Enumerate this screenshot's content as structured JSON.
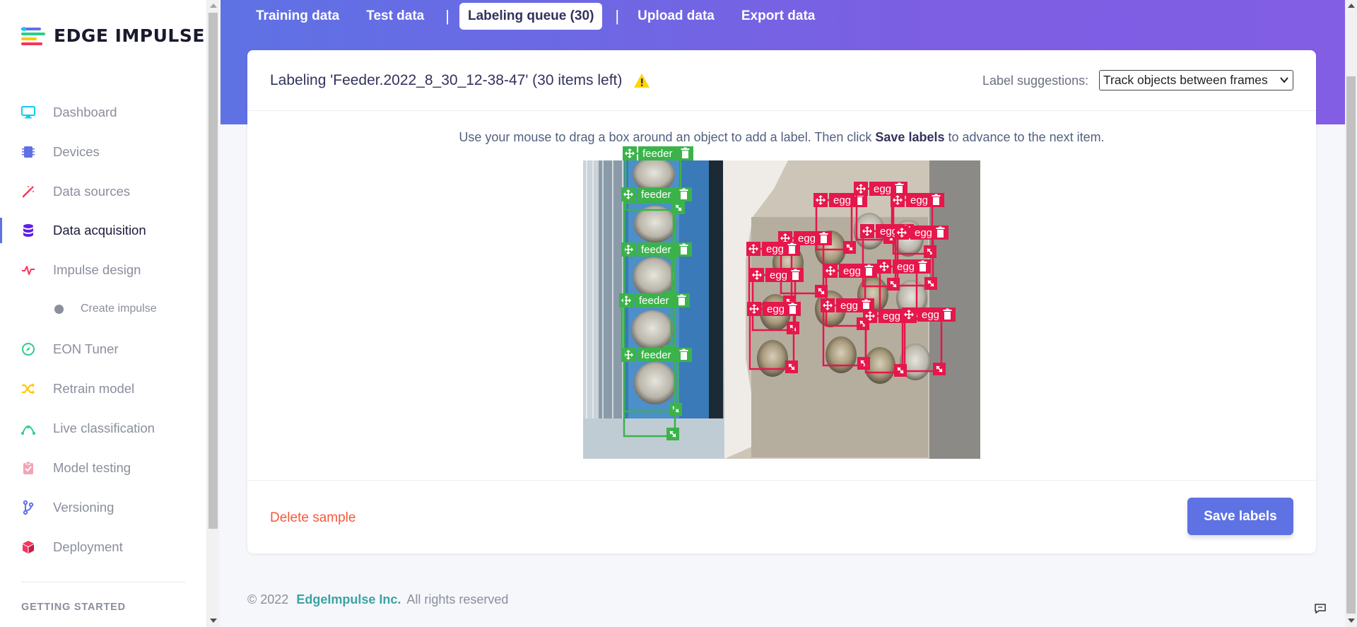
{
  "brand": {
    "name": "EDGE IMPULSE"
  },
  "sidebar": {
    "items": [
      {
        "label": "Dashboard",
        "icon": "monitor-icon",
        "color": "#11cdef"
      },
      {
        "label": "Devices",
        "icon": "chip-icon",
        "color": "#5e72e4"
      },
      {
        "label": "Data sources",
        "icon": "magic-wand-icon",
        "color": "#f5365c"
      },
      {
        "label": "Data acquisition",
        "icon": "database-icon",
        "color": "#5e1fe4"
      },
      {
        "label": "Impulse design",
        "icon": "pulse-icon",
        "color": "#f5365c"
      },
      {
        "label": "EON Tuner",
        "icon": "compass-icon",
        "color": "#2dce89"
      },
      {
        "label": "Retrain model",
        "icon": "shuffle-icon",
        "color": "#ffc800"
      },
      {
        "label": "Live classification",
        "icon": "signal-icon",
        "color": "#2dce89"
      },
      {
        "label": "Model testing",
        "icon": "clipboard-check-icon",
        "color": "#f3a4b5"
      },
      {
        "label": "Versioning",
        "icon": "branch-icon",
        "color": "#5e72e4"
      },
      {
        "label": "Deployment",
        "icon": "box-icon",
        "color": "#f5365c"
      }
    ],
    "sub_item": "Create impulse",
    "section_label": "GETTING STARTED"
  },
  "tabs": [
    {
      "label": "Training data"
    },
    {
      "label": "Test data"
    },
    {
      "label": "Labeling queue (30)"
    },
    {
      "label": "Upload data"
    },
    {
      "label": "Export data"
    }
  ],
  "card": {
    "title": "Labeling 'Feeder.2022_8_30_12-38-47' (30 items left)",
    "suggest_label": "Label suggestions:",
    "suggest_value": "Track objects between frames",
    "instruction_pre": "Use your mouse to drag a box around an object to add a label. Then click ",
    "instruction_bold": "Save labels",
    "instruction_post": " to advance to the next item.",
    "delete_label": "Delete sample",
    "save_label": "Save labels"
  },
  "labels": {
    "feeder": "feeder",
    "egg": "egg",
    "feeder_color": "#3bb34a",
    "egg_color": "#e5174b"
  },
  "footer": {
    "copyright": "© 2022",
    "company": "EdgeImpulse Inc.",
    "rights": "All rights reserved"
  },
  "colors": {
    "accent": "#5e72e4",
    "danger_text": "#f5593d",
    "warning": "#ffd600"
  }
}
